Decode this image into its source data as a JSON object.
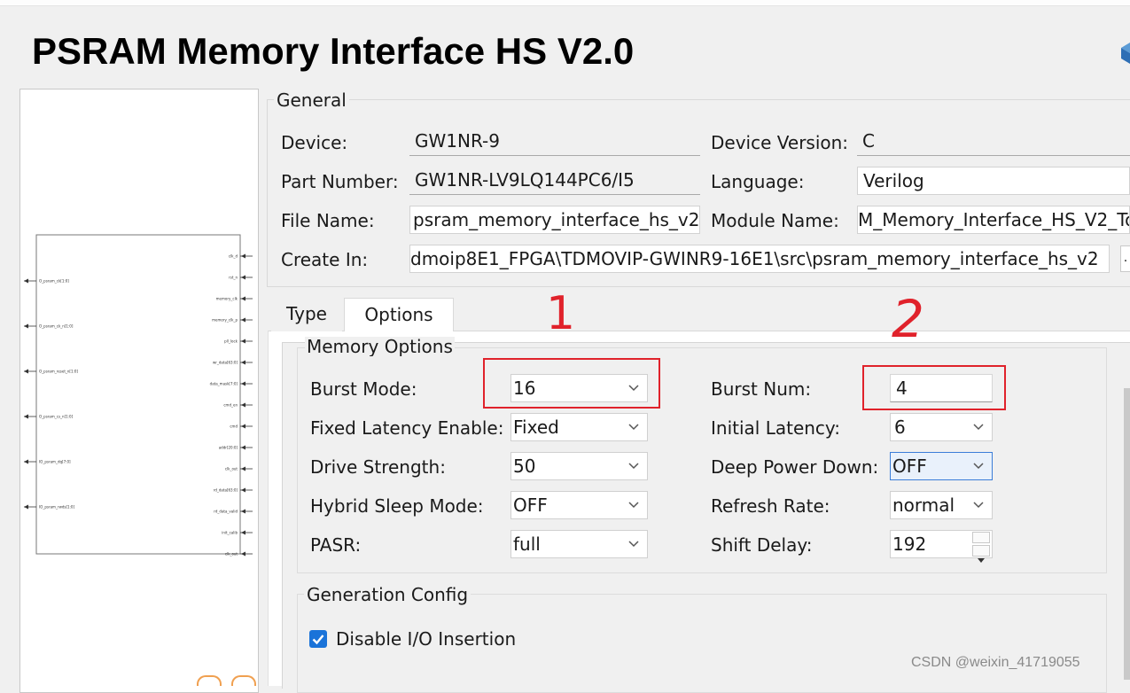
{
  "window": {
    "title": "PSRAM Memory Interface HS V2.0"
  },
  "symbol_preview": {
    "left_ports": [
      "IO_psram_dq[7:0]",
      "IO_psram_rwds[1:0]",
      "O_psram_ck[1:0]",
      "O_psram_ck_n[1:0]",
      "O_psram_reset_n[1:0]",
      "O_psram_cs_n[1:0]"
    ],
    "right_ports": [
      "clk_d",
      "rst_n",
      "memory_clk",
      "memory_clk_p",
      "pll_lock",
      "wr_data[63:0]",
      "data_mask[7:0]",
      "cmd_en",
      "cmd",
      "addr[20:0]",
      "clk_out",
      "rd_data[63:0]",
      "rd_data_valid",
      "init_calib",
      "clk_out"
    ]
  },
  "general": {
    "title": "General",
    "device_label": "Device:",
    "device_value": "GW1NR-9",
    "device_version_label": "Device Version:",
    "device_version_value": "C",
    "part_number_label": "Part Number:",
    "part_number_value": "GW1NR-LV9LQ144PC6/I5",
    "language_label": "Language:",
    "language_value": "Verilog",
    "file_name_label": "File Name:",
    "file_name_value": "psram_memory_interface_hs_v2",
    "module_name_label": "Module Name:",
    "module_name_value": "M_Memory_Interface_HS_V2_To",
    "create_in_label": "Create In:",
    "create_in_value": "dmoip8E1_FPGA\\TDMOVIP-GWINR9-16E1\\src\\psram_memory_interface_hs_v2",
    "browse_label": "."
  },
  "tabs": [
    {
      "label": "Type",
      "selected": false
    },
    {
      "label": "Options",
      "selected": true
    }
  ],
  "memory_options": {
    "title": "Memory Options",
    "burst_mode_label": "Burst Mode:",
    "burst_mode_value": "16",
    "burst_num_label": "Burst Num:",
    "burst_num_value": "4",
    "fixed_latency_label": "Fixed Latency Enable:",
    "fixed_latency_value": "Fixed",
    "initial_latency_label": "Initial Latency:",
    "initial_latency_value": "6",
    "drive_strength_label": "Drive Strength:",
    "drive_strength_value": "50",
    "deep_power_down_label": "Deep Power Down:",
    "deep_power_down_value": "OFF",
    "hybrid_sleep_label": "Hybrid Sleep Mode:",
    "hybrid_sleep_value": "OFF",
    "refresh_rate_label": "Refresh Rate:",
    "refresh_rate_value": "normal",
    "pasr_label": "PASR:",
    "pasr_value": "full",
    "shift_delay_label": "Shift Delay:",
    "shift_delay_value": "192"
  },
  "generation_config": {
    "title": "Generation Config",
    "disable_io_label": "Disable I/O Insertion",
    "disable_io_checked": true
  },
  "annotations": {
    "mark_1": "1",
    "mark_2": "2",
    "highlight_color": "#e0222b"
  },
  "watermark": "CSDN @weixin_41719055",
  "colors": {
    "accent": "#1a73d9",
    "focus_border": "#3b7dd8"
  }
}
